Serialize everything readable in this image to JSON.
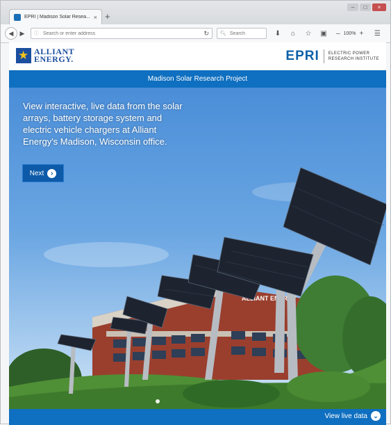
{
  "browser": {
    "tab_title": "EPRI | Madison Solar Resea...",
    "tab_close": "×",
    "new_tab": "+",
    "url_placeholder": "Search or enter address",
    "search_placeholder": "Search",
    "zoom_out": "–",
    "zoom_level": "100%",
    "zoom_in": "+"
  },
  "header": {
    "alliant_line1": "ALLIANT",
    "alliant_line2": "ENERGY.",
    "epri_logo": "EPRI",
    "epri_line1": "ELECTRIC POWER",
    "epri_line2": "RESEARCH INSTITUTE"
  },
  "title_bar": {
    "title": "Madison Solar Research Project"
  },
  "hero": {
    "description": "View interactive, live data from the solar arrays, battery storage system and electric vehicle chargers at Alliant Energy's Madison, Wisconsin office.",
    "next_label": "Next",
    "building_sign": "ALLIANT ENERGY"
  },
  "footer": {
    "view_live_label": "View live data"
  },
  "colors": {
    "brand_blue": "#0f6fc0",
    "alliant_blue": "#1b4fa0",
    "alliant_gold": "#f3c21b"
  }
}
